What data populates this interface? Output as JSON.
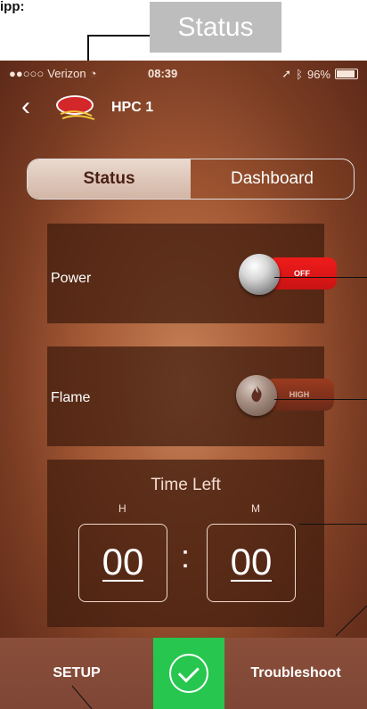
{
  "header": {
    "top_fragment": "ipp:",
    "callout": "Status"
  },
  "statusbar": {
    "carrier": "Verizon",
    "time": "08:39",
    "battery": "96%",
    "colors": {
      "accent": "#f7e6dc"
    }
  },
  "navbar": {
    "title": "HPC 1"
  },
  "tabs": [
    {
      "label": "Status"
    },
    {
      "label": "Dashboard"
    }
  ],
  "controls": {
    "power": {
      "label": "Power",
      "toggle_text": "OFF"
    },
    "flame": {
      "label": "Flame",
      "toggle_text": "HIGH"
    }
  },
  "timer": {
    "title": "Time Left",
    "hours_label": "H",
    "minutes_label": "M",
    "hours_value": "00",
    "minutes_value": "00"
  },
  "bottom_bar": {
    "setup": "SETUP",
    "troubleshoot": "Troubleshoot",
    "check_icon": "check-icon"
  },
  "icons": {
    "back": "back-icon",
    "wifi": "wifi-icon",
    "location": "location-icon",
    "bluetooth": "bluetooth-icon",
    "battery": "battery-icon",
    "logo": "hpc-logo",
    "flame": "flame-icon"
  }
}
